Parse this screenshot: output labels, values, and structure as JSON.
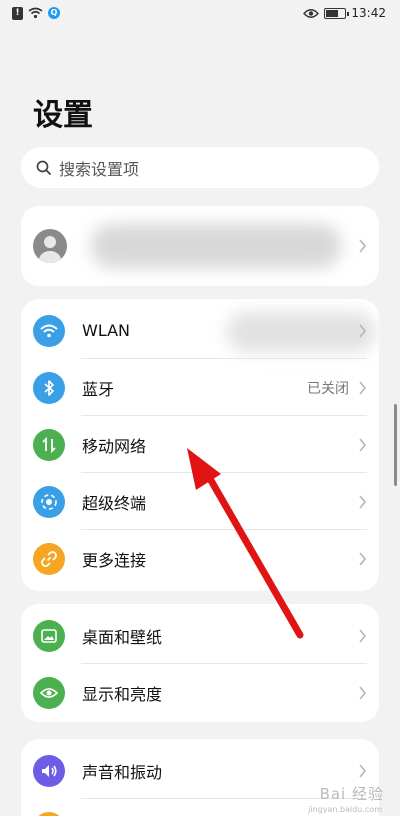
{
  "status_bar": {
    "time": "13:42"
  },
  "page_title": "设置",
  "search": {
    "placeholder": "搜索设置项"
  },
  "connectivity": [
    {
      "label": "WLAN",
      "value": "",
      "icon": "wifi-icon",
      "color": "#3aa0e6"
    },
    {
      "label": "蓝牙",
      "value": "已关闭",
      "icon": "bluetooth-icon",
      "color": "#3aa0e6"
    },
    {
      "label": "移动网络",
      "value": "",
      "icon": "mobile-network-icon",
      "color": "#4caf50"
    },
    {
      "label": "超级终端",
      "value": "",
      "icon": "super-device-icon",
      "color": "#3aa0e6"
    },
    {
      "label": "更多连接",
      "value": "",
      "icon": "link-icon",
      "color": "#f5a623"
    }
  ],
  "display": [
    {
      "label": "桌面和壁纸",
      "icon": "wallpaper-icon",
      "color": "#4caf50"
    },
    {
      "label": "显示和亮度",
      "icon": "eye-icon",
      "color": "#4caf50"
    }
  ],
  "sound": [
    {
      "label": "声音和振动",
      "icon": "volume-icon",
      "color": "#6f5ce6"
    }
  ],
  "watermark": {
    "main": "Bai 经验",
    "sub": "jingyan.baidu.com"
  }
}
